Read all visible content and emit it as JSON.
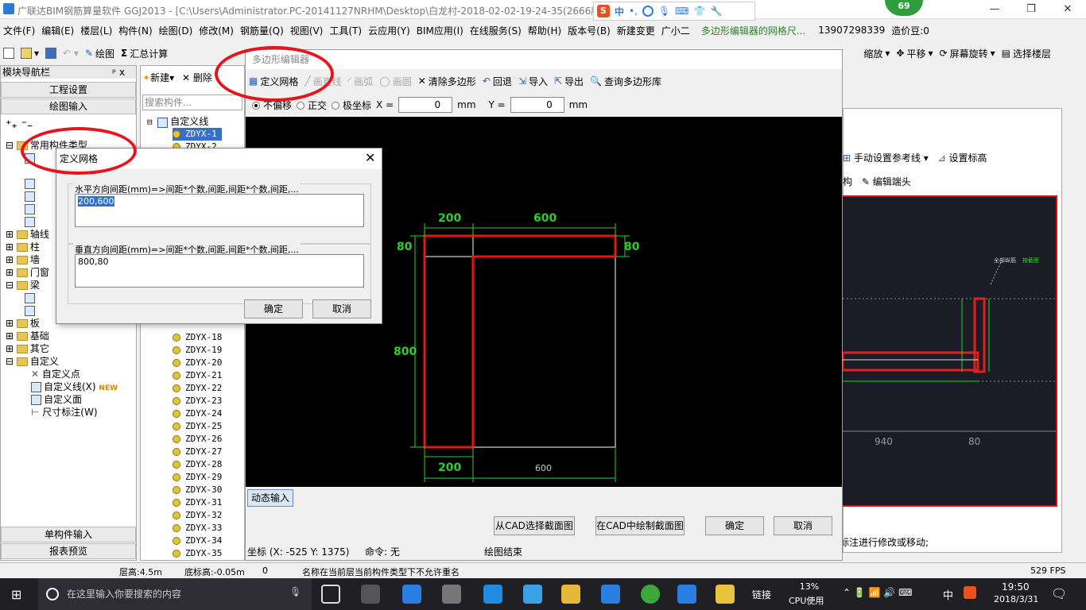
{
  "window": {
    "title": "广联达BIM钢筋算量软件 GGJ2013 - [C:\\Users\\Administrator.PC-20141127NRHM\\Desktop\\白龙村-2018-02-02-19-24-35(2666版"
  },
  "ime": {
    "s": "S",
    "lang": "中"
  },
  "badge": "69",
  "menu": [
    "文件(F)",
    "编辑(E)",
    "楼层(L)",
    "构件(N)",
    "绘图(D)",
    "修改(M)",
    "钢筋量(Q)",
    "视图(V)",
    "工具(T)",
    "云应用(Y)",
    "BIM应用(I)",
    "在线服务(S)",
    "帮助(H)",
    "版本号(B)",
    "新建变更",
    "广小二"
  ],
  "menu_right": {
    "notice": "多边形编辑器的网格尺...",
    "phone": "13907298339",
    "price": "造价豆:0"
  },
  "toolbar": {
    "draw": "绘图",
    "sum": "汇总计算",
    "zoom": "缩放",
    "pan": "平移",
    "rotate": "屏幕旋转",
    "select_floor": "选择楼层"
  },
  "nav": {
    "title": "模块导航栏",
    "pin": "ᵖ x",
    "project": "工程设置",
    "drawing": "绘图输入",
    "single": "单构件输入",
    "report": "报表预览",
    "tree": [
      "常用构件类型",
      "轴线",
      "柱",
      "墙",
      "门窗",
      "梁",
      "板",
      "基础",
      "其它",
      "自定义",
      "自定义点",
      "自定义线(X)",
      "自定义面",
      "尺寸标注(W)"
    ],
    "new_badge": "NEW"
  },
  "list": {
    "new": "新建",
    "delete": "删除",
    "search_placeholder": "搜索构件...",
    "root": "自定义线",
    "items": [
      "ZDYX-1",
      "ZDYX-2",
      "ZDYX-18",
      "ZDYX-19",
      "ZDYX-20",
      "ZDYX-21",
      "ZDYX-22",
      "ZDYX-23",
      "ZDYX-24",
      "ZDYX-25",
      "ZDYX-26",
      "ZDYX-27",
      "ZDYX-28",
      "ZDYX-29",
      "ZDYX-30",
      "ZDYX-31",
      "ZDYX-32",
      "ZDYX-33",
      "ZDYX-34",
      "ZDYX-35"
    ]
  },
  "poly": {
    "title": "多边形编辑器",
    "define_grid": "定义网格",
    "line": "画直线",
    "arc": "画弧",
    "circle": "画圆",
    "clear": "清除多边形",
    "undo": "回退",
    "import": "导入",
    "export": "导出",
    "query": "查询多边形库",
    "opt_nooffset": "不偏移",
    "opt_ortho": "正交",
    "opt_polar": "极坐标",
    "x_label": "X =",
    "x_val": "0",
    "y_label": "Y =",
    "y_val": "0",
    "unit": "mm",
    "dyn": "动态输入",
    "from_cad": "从CAD选择截面图",
    "draw_cad": "在CAD中绘制截面图",
    "ok": "确定",
    "cancel": "取消",
    "coord": "坐标 (X: -525 Y: 1375)",
    "cmd": "命令: 无",
    "state": "绘图结束",
    "dims": {
      "top_a": "200",
      "top_b": "600",
      "left_h": "800",
      "left_t": "80",
      "right_t": "80",
      "bottom_a": "200",
      "bottom_b": "600"
    }
  },
  "dialog": {
    "title": "定义网格",
    "h_label": "水平方向间距(mm)=>间距*个数,间距,间距*个数,间距,...",
    "h_value": "200,600",
    "v_label": "垂直方向间距(mm)=>间距*个数,间距,间距*个数,间距,...",
    "v_value": "800,80",
    "ok": "确定",
    "cancel": "取消"
  },
  "right": {
    "manual_ref": "手动设置参考线",
    "set_elev": "设置标高",
    "edit_end": "编辑端头",
    "frag": "构",
    "bottom_note": "标注进行修改或移动;",
    "label_940": "940",
    "label_80": "80",
    "note_top": "全部纵筋",
    "note_top2": "按截面"
  },
  "status": {
    "floor_h": "层高:4.5m",
    "base_h": "底标高:-0.05m",
    "zero": "0",
    "msg": "名称在当前层当前构件类型下不允许重名",
    "fps": "529 FPS"
  },
  "taskbar": {
    "search": "在这里输入你要搜索的内容",
    "link": "链接",
    "cpu": "13%",
    "cpu_label": "CPU使用",
    "lang": "中",
    "time": "19:50",
    "date": "2018/3/31"
  }
}
